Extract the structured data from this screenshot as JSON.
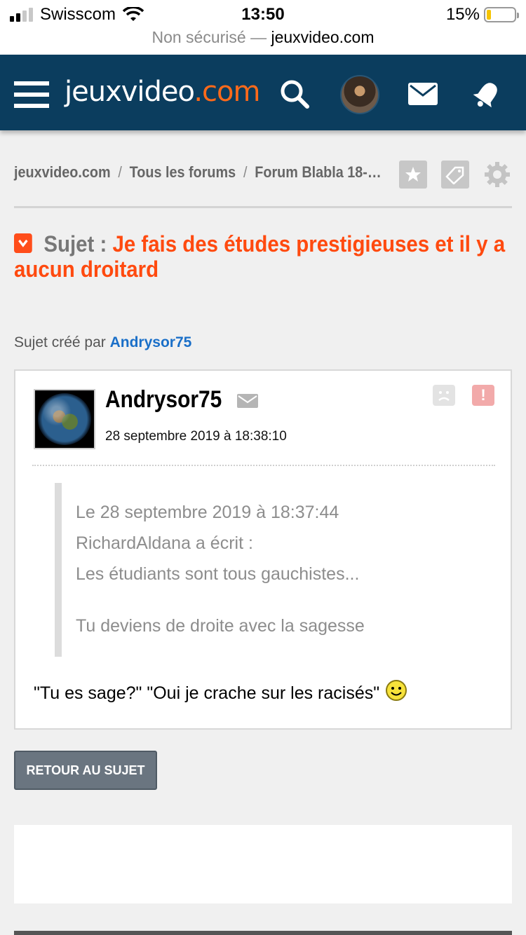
{
  "status_bar": {
    "carrier": "Swisscom",
    "time": "13:50",
    "battery_percent": "15%",
    "battery_level": 0.15,
    "signal_bars_active": 2,
    "signal_bars_total": 4
  },
  "url_bar": {
    "security": "Non sécurisé —",
    "domain": "jeuxvideo.com"
  },
  "header": {
    "logo_main": "jeuxvideo",
    "logo_suffix": ".com",
    "icons": [
      "menu-icon",
      "search-icon",
      "user-avatar",
      "mail-icon",
      "bell-icon"
    ],
    "colors": {
      "background": "#0b3d5e",
      "accent": "#ff6a1a"
    }
  },
  "breadcrumb": {
    "items": [
      "jeuxvideo.com",
      "Tous les forums",
      "Forum Blabla 18-…"
    ],
    "separator": "/",
    "actions": [
      "star-icon",
      "tag-icon",
      "gear-icon"
    ]
  },
  "topic": {
    "label": "Sujet :",
    "title": "Je fais des études prestigieuses et il y a aucun droitard",
    "title_color": "#ff4a0f"
  },
  "created_by": {
    "prefix": "Sujet créé par",
    "author": "Andrysor75"
  },
  "post": {
    "author": "Andrysor75",
    "date": "28 septembre 2019 à 18:38:10",
    "quote": {
      "header": "Le 28 septembre 2019 à 18:37:44",
      "wrote": "RichardAldana a écrit :",
      "line1": "Les étudiants sont tous gauchistes...",
      "line2": "Tu deviens de droite avec la sagesse"
    },
    "message": "\"Tu es sage?\" \"Oui je crache sur les racisés\""
  },
  "buttons": {
    "back": "RETOUR AU SUJET"
  }
}
